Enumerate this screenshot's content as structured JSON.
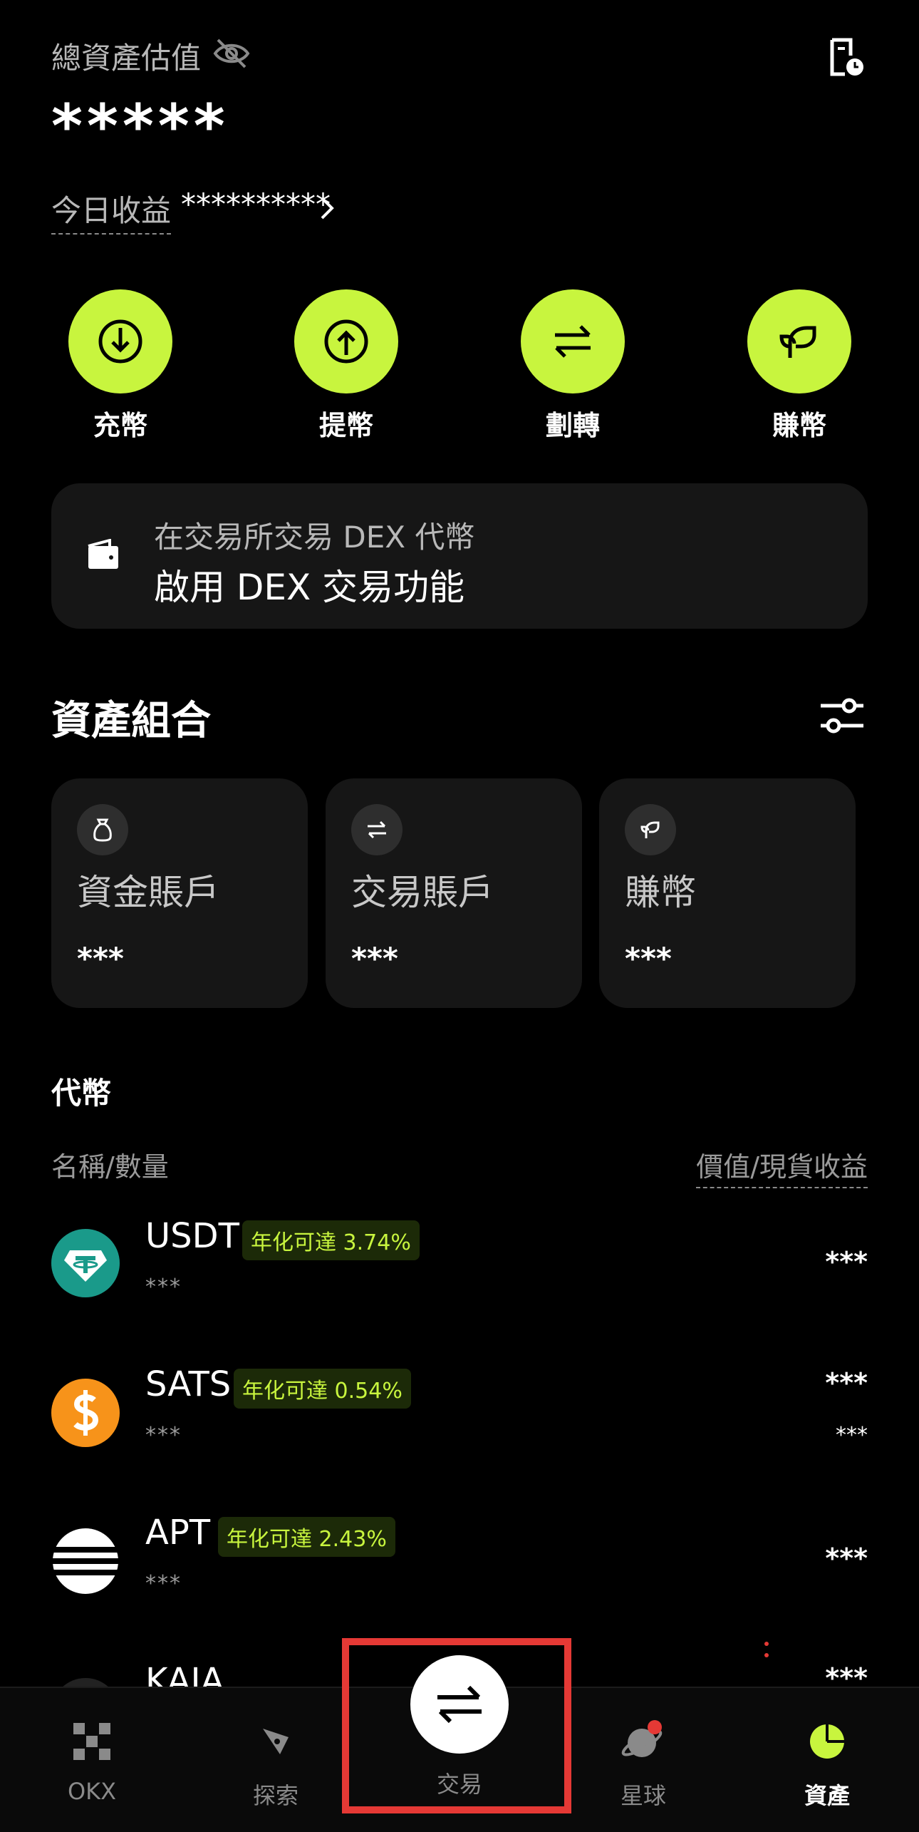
{
  "header": {
    "total_label": "總資產估值",
    "total_value": "*****",
    "today_label": "今日收益",
    "today_value": "**********"
  },
  "actions": [
    {
      "label": "充幣",
      "icon": "deposit-icon"
    },
    {
      "label": "提幣",
      "icon": "withdraw-icon"
    },
    {
      "label": "劃轉",
      "icon": "transfer-icon"
    },
    {
      "label": "賺幣",
      "icon": "earn-leaf-icon"
    }
  ],
  "dex_card": {
    "line1": "在交易所交易 DEX 代幣",
    "line2": "啟用 DEX 交易功能"
  },
  "portfolio": {
    "title": "資產組合",
    "accounts": [
      {
        "name": "資金賬戶",
        "value": "***",
        "icon": "wallet-bag-icon"
      },
      {
        "name": "交易賬戶",
        "value": "***",
        "icon": "transfer-icon"
      },
      {
        "name": "賺幣",
        "value": "***",
        "icon": "earn-leaf-icon"
      }
    ]
  },
  "tokens": {
    "title": "代幣",
    "col_left": "名稱/數量",
    "col_right": "價值/現貨收益",
    "items": [
      {
        "symbol": "USDT",
        "badge": "年化可達 3.74%",
        "qty": "***",
        "value": "***",
        "pnl": "",
        "color": "#1a9a8a"
      },
      {
        "symbol": "SATS",
        "badge": "年化可達 0.54%",
        "qty": "***",
        "value": "***",
        "pnl": "***",
        "color": "#f7931a"
      },
      {
        "symbol": "APT",
        "badge": "年化可達 2.43%",
        "qty": "***",
        "value": "***",
        "pnl": "",
        "color": "#ffffff"
      },
      {
        "symbol": "KAIA",
        "badge": "",
        "qty": "",
        "value": "***",
        "pnl": "",
        "color": "#333333"
      }
    ]
  },
  "tabbar": {
    "items": [
      {
        "label": "OKX",
        "icon": "okx-logo-icon"
      },
      {
        "label": "探索",
        "icon": "compass-icon"
      },
      {
        "label": "交易",
        "icon": "trade-swap-icon"
      },
      {
        "label": "星球",
        "icon": "planet-icon"
      },
      {
        "label": "資產",
        "icon": "pie-chart-icon"
      }
    ]
  },
  "colors": {
    "accent": "#c8f53e",
    "background": "#000000",
    "card": "#161616",
    "highlight": "#e53935"
  }
}
